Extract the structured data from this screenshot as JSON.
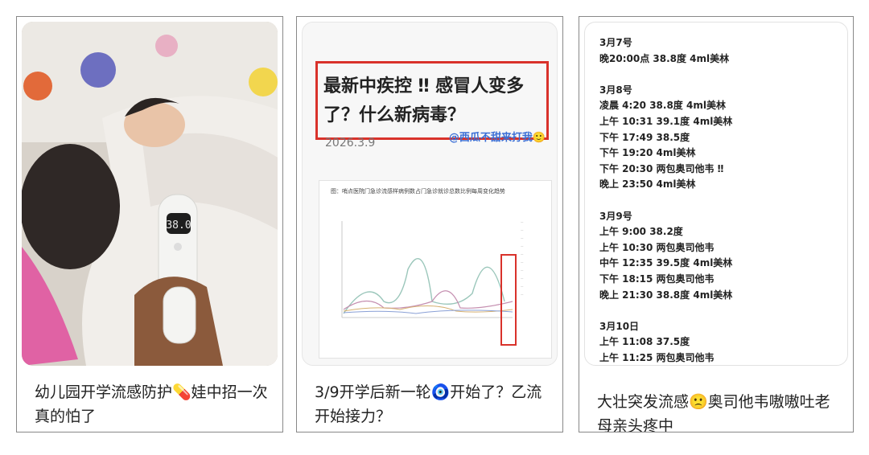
{
  "cards": [
    {
      "caption": "幼儿园开学流感防护💊娃中招一次真的怕了",
      "thermometer_reading": "38.0"
    },
    {
      "headline": "最新中疾控 ‼ 感冒人变多了？什么新病毒？",
      "date": "2026.3.9",
      "handle": "@西瓜不甜来打我🙂",
      "chart_title": "图：哨点医院门急诊流感样病例数占门急诊就诊总数比例每周变化趋势",
      "caption": "3/9开学后新一轮🧿开始了？乙流开始接力？"
    },
    {
      "note": "3月7号\n晚20:00点 38.8度 4ml美林\n\n3月8号\n凌晨 4:20 38.8度 4ml美林\n上午 10:31 39.1度 4ml美林\n下午 17:49 38.5度\n下午 19:20 4ml美林\n下午 20:30 两包奥司他韦 ‼\n晚上 23:50 4ml美林\n\n3月9号\n上午 9:00 38.2度\n上午 10:30 两包奥司他韦\n中午 12:35 39.5度 4ml美林\n下午 18:15 两包奥司他韦\n晚上 21:30 38.8度 4ml美林\n\n3月10日\n上午 11:08 37.5度\n上午 11:25 两包奥司他韦",
      "caption": "大壮突发流感🙁奥司他韦嗷嗷吐老母亲头疼中"
    }
  ],
  "colors": {
    "red_highlight": "#d9322b",
    "handle_blue": "#3b6fd6",
    "border": "#888888"
  }
}
